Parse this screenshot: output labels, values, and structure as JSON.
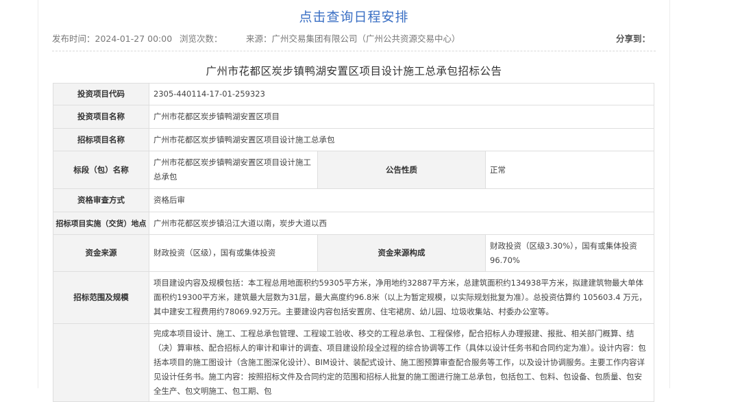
{
  "header": {
    "schedule_link": "点击查询日程安排",
    "publish_time": "发布时间：2024-01-27 00:00",
    "view_count": "浏览次数：",
    "source": "来源：广州交易集团有限公司（广州公共资源交易中心）",
    "share": "分享到："
  },
  "document": {
    "title": "广州市花都区炭步镇鸭湖安置区项目设计施工总承包招标公告"
  },
  "table": {
    "project_code_label": "投资项目代码",
    "project_code": "2305-440114-17-01-259323",
    "project_name_label": "投资项目名称",
    "project_name": "广州市花都区炭步镇鸭湖安置区项目",
    "tender_name_label": "招标项目名称",
    "tender_name": "广州市花都区炭步镇鸭湖安置区项目设计施工总承包",
    "section_label": "标段（包）名称",
    "section_name": "广州市花都区炭步镇鸭湖安置区项目设计施工总承包",
    "notice_nature_label": "公告性质",
    "notice_nature": "正常",
    "qualification_label": "资格审查方式",
    "qualification": "资格后审",
    "location_label": "招标项目实施（交货）地点",
    "location": "广州市花都区炭步镇沿江大道以南，炭步大道以西",
    "fund_source_label": "资金来源",
    "fund_source": "财政投资（区级），国有或集体投资",
    "fund_composition_label": "资金来源构成",
    "fund_composition": "财政投资（区级3.30%），国有或集体投资96.70%",
    "scope_label": "招标范围及规模",
    "scope_text": "项目建设内容及规模包括：本工程总用地面积约59305平方米，净用地约32887平方米，总建筑面积约134938平方米，拟建建筑物最大单体面积约19300平方米，建筑最大层数为31层，最大高度约96.8米（以上为暂定规模，以实际规划批复为准）。总投资估算约 105603.4 万元，其中建安工程费用约78069.92万元。主要建设内容包括安置房、住宅裙房、幼儿园、垃圾收集站、村委办公室等。",
    "scope_text_2": "完成本项目设计、施工、工程总承包管理、工程竣工验收、移交的工程总承包、工程保修，配合招标人办理报建、报批、相关部门概算、结（决）算审核、配合招标人的审计和审计的调查、项目建设阶段全过程的综合协调等工作（具体以设计任务书和合同约定为准）。设计内容：包括本项目的施工图设计（含施工图深化设计）、BIM设计、装配式设计、施工图预算审查配合服务等工作，以及设计协调服务。主要工作内容详见设计任务书。施工内容：按照招标文件及合同约定的范围和招标人批复的施工图进行施工总承包，包括包工、包料、包设备、包质量、包安全生产、包文明施工、包工期、包"
  }
}
